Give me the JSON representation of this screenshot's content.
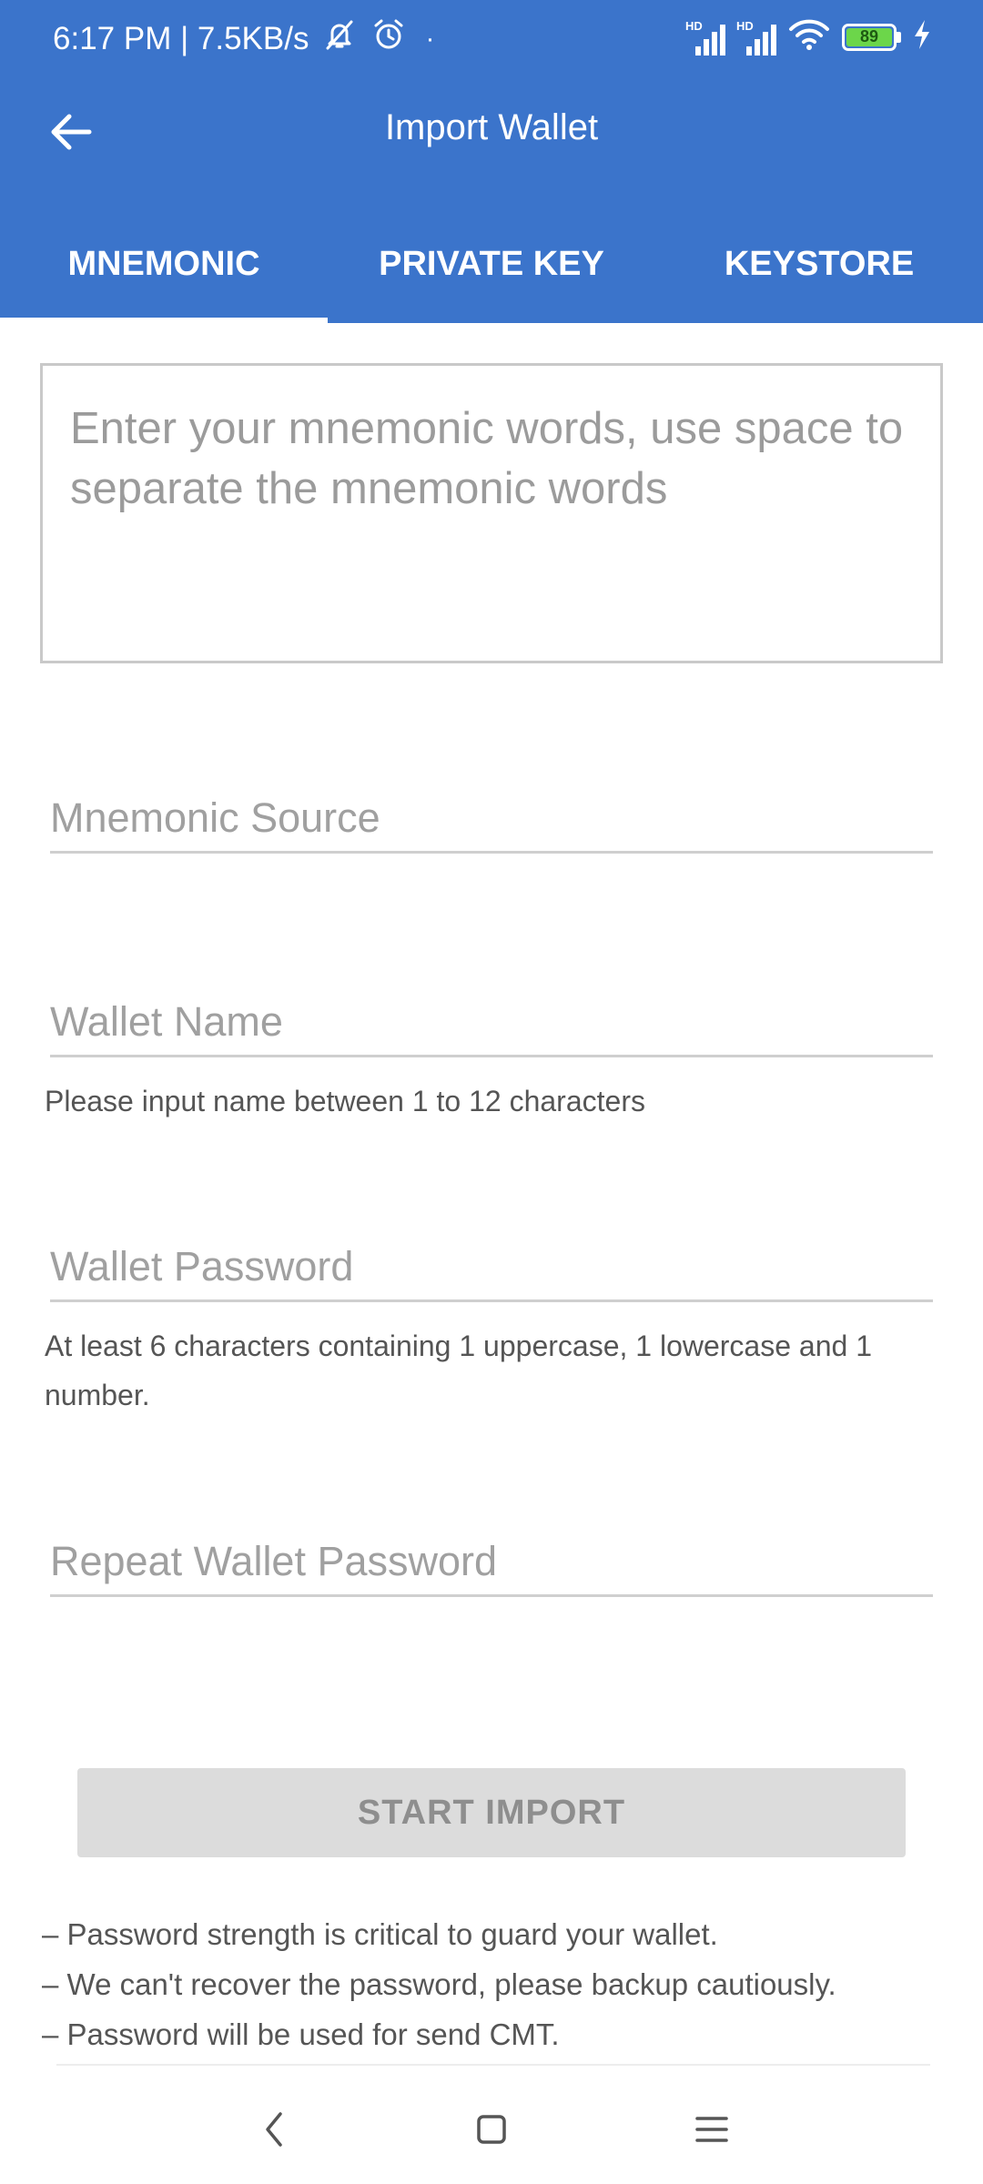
{
  "status_bar": {
    "time_speed": "6:17 PM | 7.5KB/s",
    "dot": "·",
    "hd1": "HD",
    "hd2": "HD",
    "battery": "89"
  },
  "header": {
    "title": "Import Wallet"
  },
  "tabs": [
    {
      "label": "MNEMONIC",
      "selected": true
    },
    {
      "label": "PRIVATE KEY",
      "selected": false
    },
    {
      "label": "KEYSTORE",
      "selected": false
    }
  ],
  "form": {
    "mnemonic_placeholder": "Enter your mnemonic words, use space to separate the mnemonic words",
    "mnemonic_source_placeholder": "Mnemonic Source",
    "wallet_name_placeholder": "Wallet Name",
    "wallet_name_hint": "Please input name between 1 to 12 characters",
    "wallet_password_placeholder": "Wallet Password",
    "wallet_password_hint": "At least 6 characters containing 1 uppercase, 1 lowercase and 1 number.",
    "repeat_password_placeholder": "Repeat Wallet Password",
    "import_button": "START IMPORT"
  },
  "notes": [
    "– Password strength is critical to guard your wallet.",
    "– We can't recover the password, please backup cautiously.",
    "– Password will be used for send CMT."
  ],
  "colors": {
    "header": "#3b74cb",
    "button_disabled": "#dcdcdc",
    "battery": "#6cd64a"
  },
  "icons": [
    "back-arrow-icon",
    "mute-icon",
    "alarm-icon",
    "signal-icon",
    "wifi-icon",
    "battery-icon",
    "charging-icon",
    "nav-back-icon",
    "nav-home-icon",
    "nav-menu-icon"
  ]
}
